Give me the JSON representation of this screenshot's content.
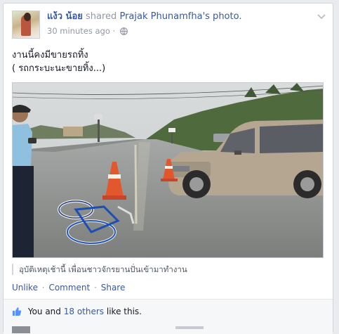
{
  "post": {
    "author": "แง้ว น้อย",
    "shared_text": "shared",
    "owner_photo": "Prajak Phunamfha's photo.",
    "timestamp": "30 minutes ago",
    "audience_icon": "globe-icon",
    "text_line1": "งานนี้คงมีขายรถทิ้ง",
    "text_line2": "( รถกระบะนะขายทิ้ง...)",
    "photo_caption": "อุบัติเหตุเช้านี้ เพื่อนชาวจักรยานปั่นเข้ามาทำงาน"
  },
  "actions": {
    "unlike": "Unlike",
    "comment": "Comment",
    "share": "Share",
    "separator": "·"
  },
  "likes": {
    "prefix": "You and",
    "others": "18 others",
    "suffix": "like this.",
    "icon": "thumbs-up-icon"
  },
  "colors": {
    "link": "#3b5998",
    "muted": "#9197a3",
    "background": "#e9ebee"
  }
}
